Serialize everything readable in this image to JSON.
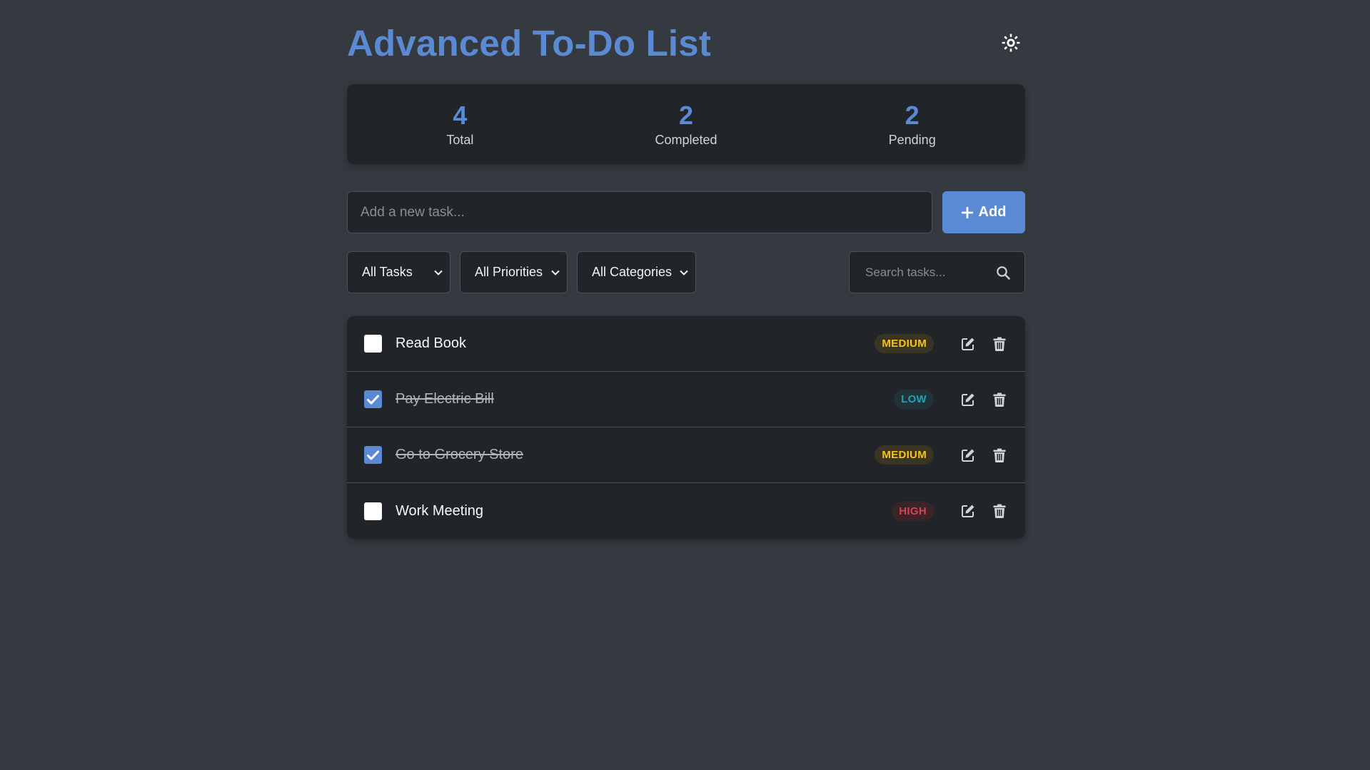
{
  "header": {
    "title": "Advanced To-Do List",
    "theme_icon": "sun-icon"
  },
  "stats": [
    {
      "value": "4",
      "label": "Total"
    },
    {
      "value": "2",
      "label": "Completed"
    },
    {
      "value": "2",
      "label": "Pending"
    }
  ],
  "add": {
    "placeholder": "Add a new task...",
    "button_label": "Add",
    "button_icon": "plus-icon"
  },
  "filters": {
    "status": "All Tasks",
    "priority": "All Priorities",
    "category": "All Categories",
    "search_placeholder": "Search tasks...",
    "search_icon": "search-icon"
  },
  "tasks": [
    {
      "text": "Read Book",
      "done": false,
      "priority": "MEDIUM"
    },
    {
      "text": "Pay Electric Bill",
      "done": true,
      "priority": "LOW"
    },
    {
      "text": "Go to Grocery Store",
      "done": true,
      "priority": "MEDIUM"
    },
    {
      "text": "Work Meeting",
      "done": false,
      "priority": "HIGH"
    }
  ],
  "colors": {
    "accent": "#5b8ad5",
    "background": "#343a40",
    "panel": "#212529",
    "medium": "#f5c518",
    "low": "#22a2b8",
    "high": "#d9434d"
  }
}
